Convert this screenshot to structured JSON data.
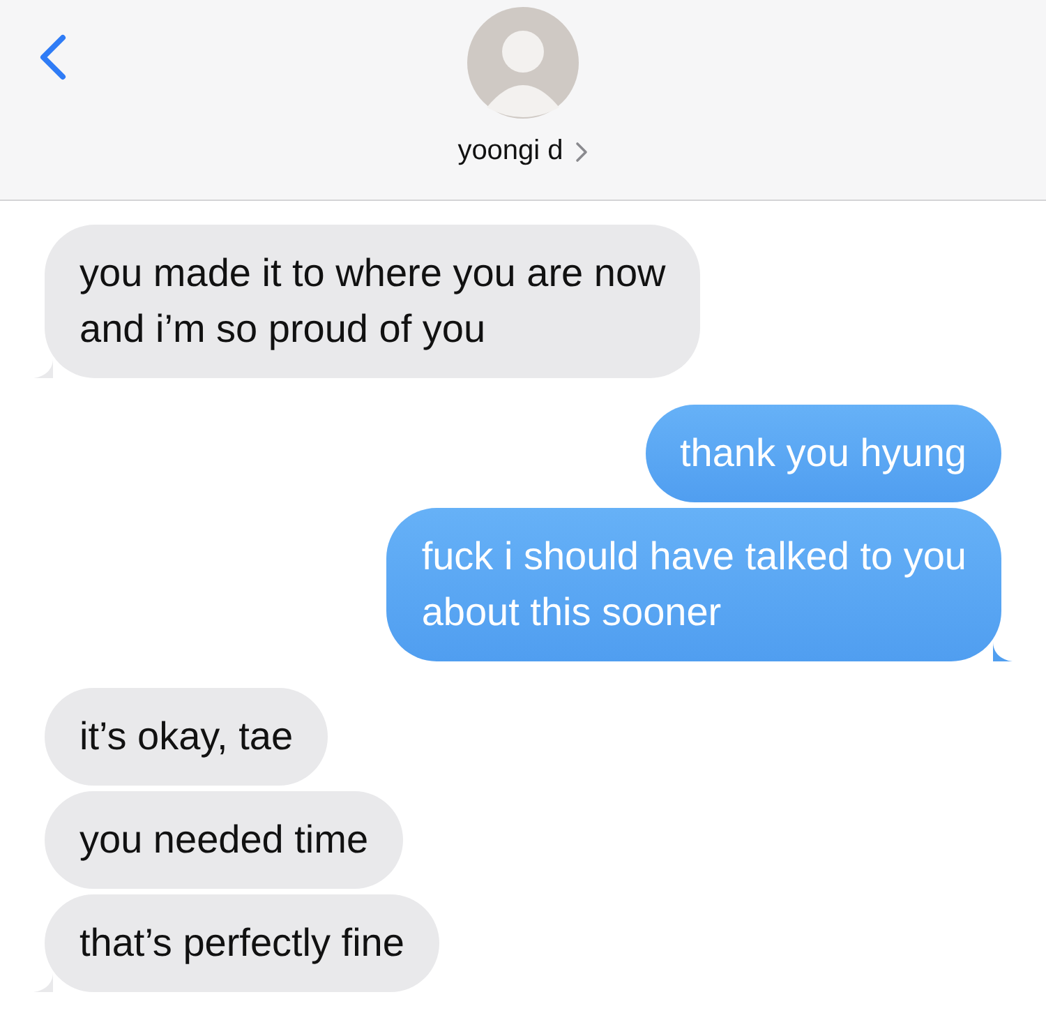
{
  "header": {
    "contact_name": "yoongi d"
  },
  "messages": [
    {
      "text": "you made it to where you are now\nand i’m so proud of you",
      "kind": "received",
      "tail": true
    },
    {
      "text": "thank you hyung",
      "kind": "sent",
      "tail": false
    },
    {
      "text": "fuck i should have talked to you\nabout this sooner",
      "kind": "sent",
      "tail": true
    },
    {
      "text": "it’s okay, tae",
      "kind": "received",
      "tail": false
    },
    {
      "text": "you needed time",
      "kind": "received",
      "tail": false
    },
    {
      "text": "that’s perfectly fine",
      "kind": "received",
      "tail": true
    }
  ]
}
